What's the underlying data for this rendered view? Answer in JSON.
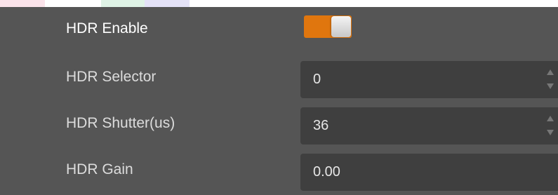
{
  "properties": [
    {
      "label": "HDR Enable",
      "type": "toggle",
      "checked": true
    },
    {
      "label": "HDR Selector",
      "type": "spin",
      "value": "0"
    },
    {
      "label": "HDR Shutter(us)",
      "type": "spin",
      "value": "36"
    },
    {
      "label": "HDR Gain",
      "type": "text",
      "value": "0.00"
    }
  ],
  "colors": {
    "panel_background": "#555555",
    "field_background": "#3f3f3f",
    "toggle_on": "#e0760e"
  },
  "icons": {
    "spin_up": "triangle-up-icon",
    "spin_down": "triangle-down-icon"
  }
}
